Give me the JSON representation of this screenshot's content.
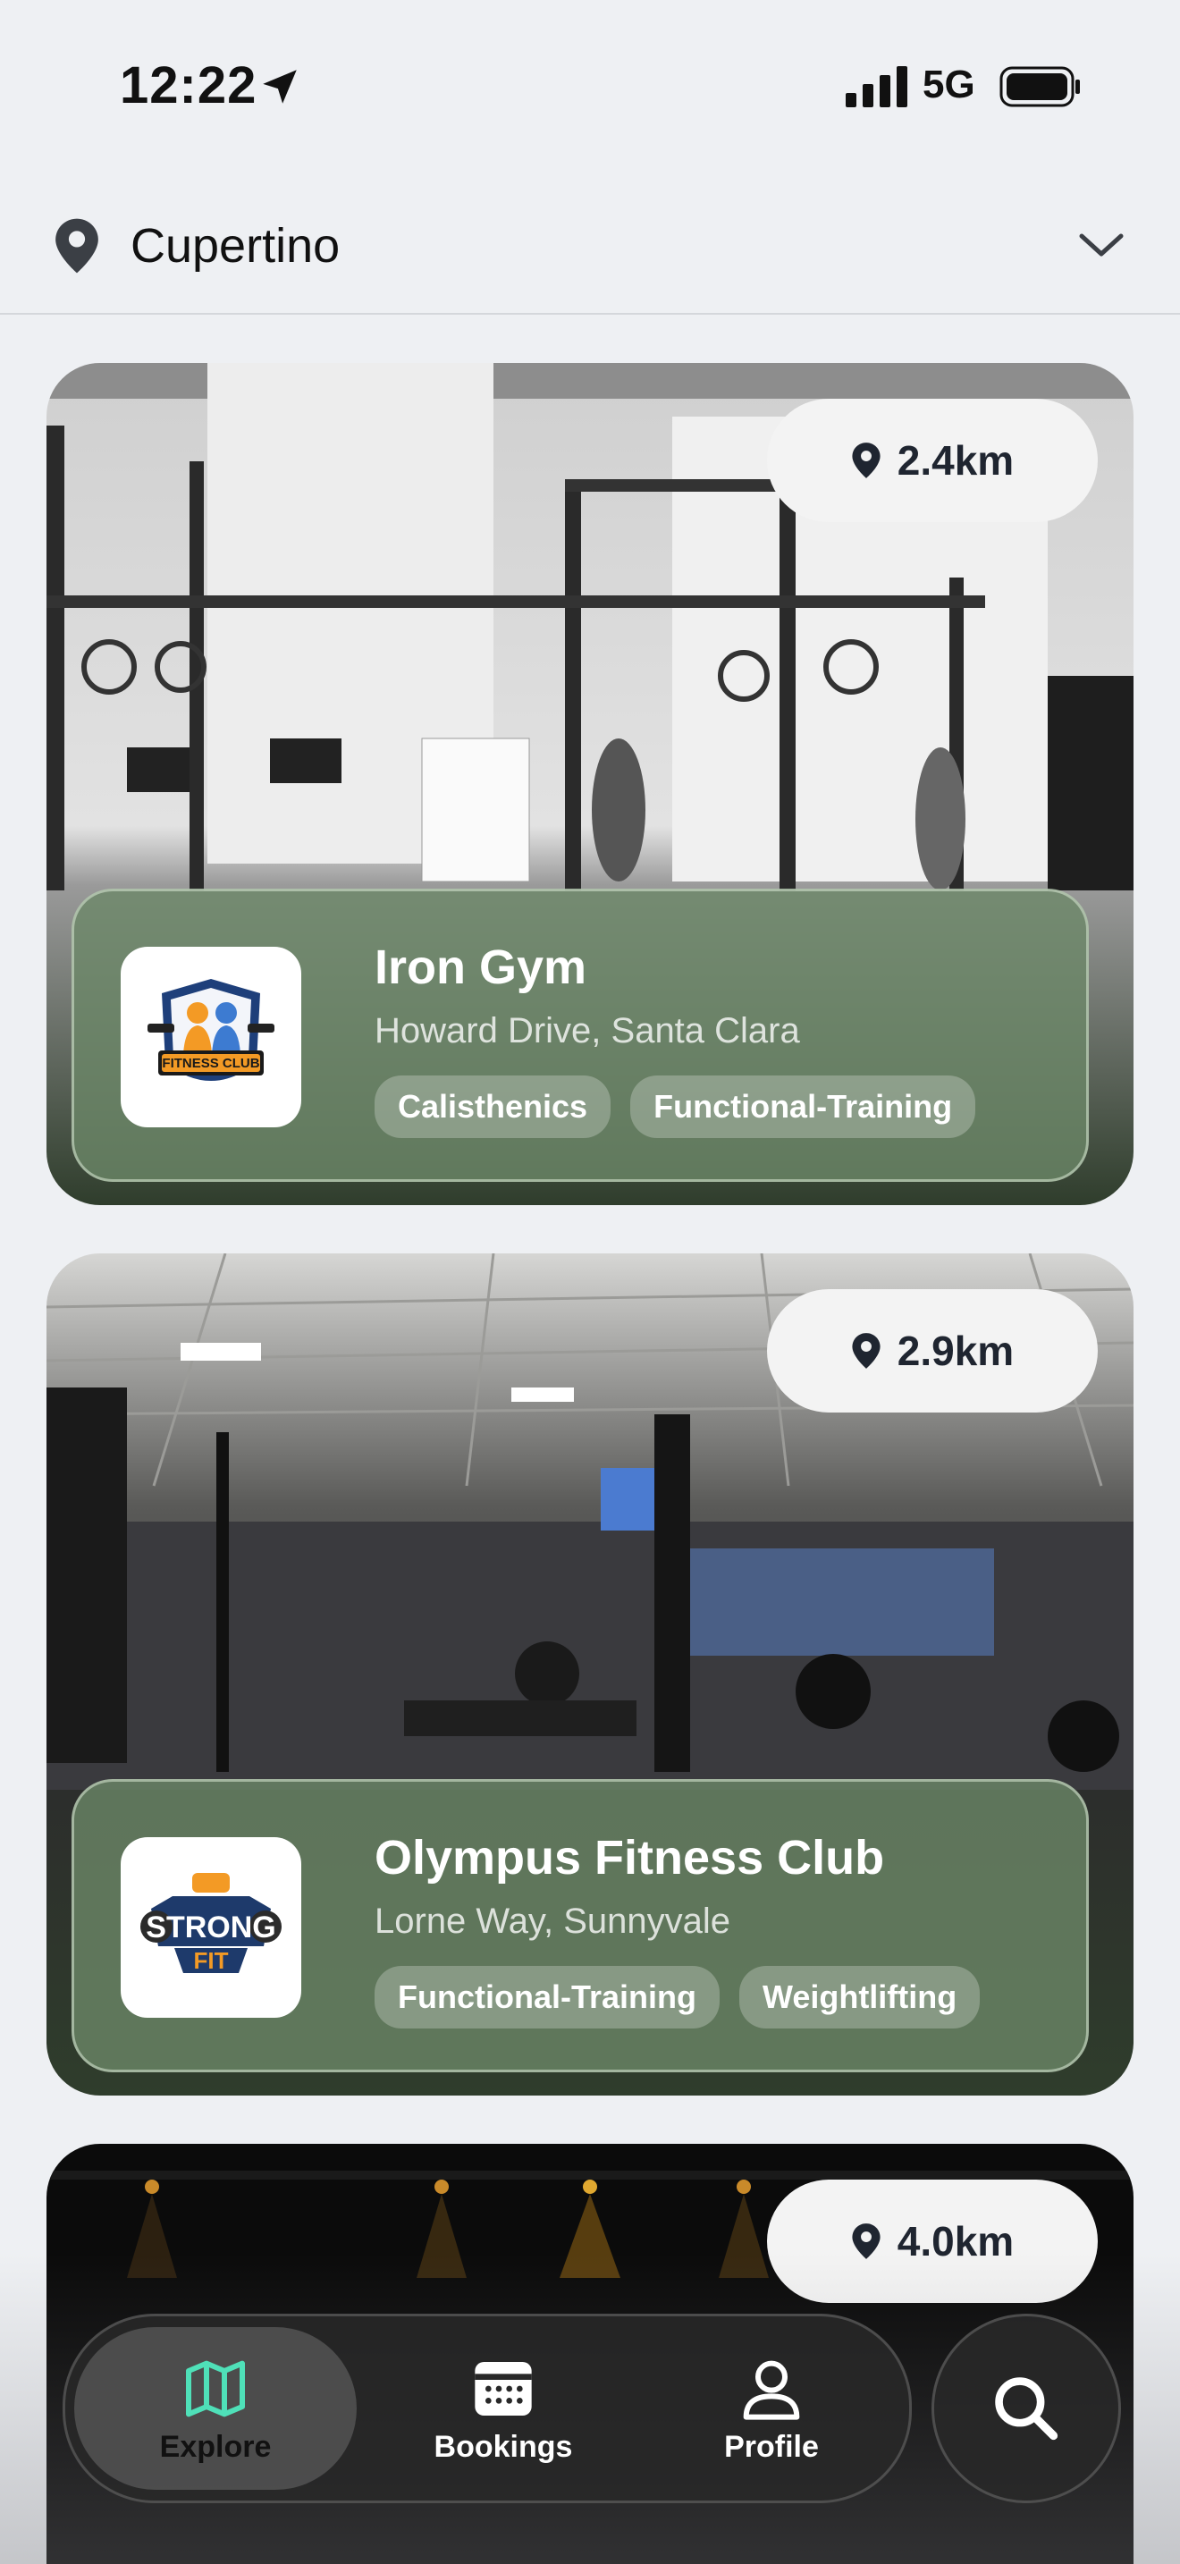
{
  "status_bar": {
    "time": "12:22",
    "network": "5G"
  },
  "location": {
    "name": "Cupertino"
  },
  "gyms": [
    {
      "distance": "2.4km",
      "name": "Iron Gym",
      "address": "Howard Drive, Santa Clara",
      "tags": [
        "Calisthenics",
        "Functional-Training"
      ],
      "logo_text": "FITNESS CLUB"
    },
    {
      "distance": "2.9km",
      "name": "Olympus Fitness Club",
      "address": "Lorne Way, Sunnyvale",
      "tags": [
        "Functional-Training",
        "Weightlifting"
      ],
      "logo_text_top": "STRONG",
      "logo_text_bottom": "FIT"
    },
    {
      "distance": "4.0km"
    }
  ],
  "nav": {
    "explore": "Explore",
    "bookings": "Bookings",
    "profile": "Profile"
  },
  "colors": {
    "explore_accent": "#4fe0b8",
    "panel_green": "#6c8768",
    "nav_dark": "#282828"
  }
}
